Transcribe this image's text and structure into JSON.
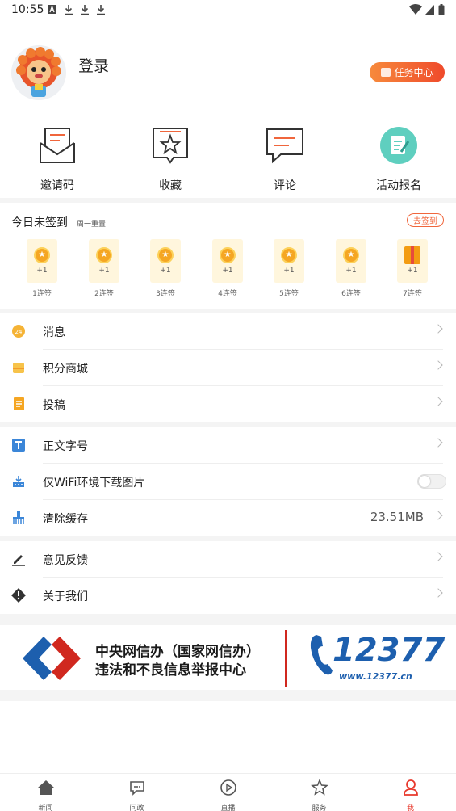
{
  "status_bar": {
    "time": "10:55"
  },
  "profile": {
    "login_label": "登录",
    "task_center_label": "任务中心"
  },
  "quick_actions": [
    {
      "label": "邀请码",
      "icon": "envelope-icon"
    },
    {
      "label": "收藏",
      "icon": "star-bookmark-icon"
    },
    {
      "label": "评论",
      "icon": "comment-icon"
    },
    {
      "label": "活动报名",
      "icon": "signup-icon"
    }
  ],
  "sign_in": {
    "title": "今日未签到",
    "subtitle": "周一重置",
    "button_label": "去签到",
    "days": [
      {
        "reward": "+1",
        "label": "1连签",
        "icon": "coin-icon"
      },
      {
        "reward": "+1",
        "label": "2连签",
        "icon": "coin-icon"
      },
      {
        "reward": "+1",
        "label": "3连签",
        "icon": "coin-icon"
      },
      {
        "reward": "+1",
        "label": "4连签",
        "icon": "coin-icon"
      },
      {
        "reward": "+1",
        "label": "5连签",
        "icon": "coin-icon"
      },
      {
        "reward": "+1",
        "label": "6连签",
        "icon": "coin-icon"
      },
      {
        "reward": "+1",
        "label": "7连签",
        "icon": "gift-icon"
      }
    ]
  },
  "menu_group_1": [
    {
      "label": "消息",
      "icon": "message-icon"
    },
    {
      "label": "积分商城",
      "icon": "points-mall-icon"
    },
    {
      "label": "投稿",
      "icon": "submit-article-icon"
    }
  ],
  "menu_group_2": [
    {
      "label": "正文字号",
      "icon": "font-size-icon"
    },
    {
      "label": "仅WiFi环境下载图片",
      "icon": "wifi-download-icon",
      "toggle": false
    },
    {
      "label": "清除缓存",
      "icon": "clear-cache-icon",
      "value": "23.51MB"
    }
  ],
  "menu_group_3": [
    {
      "label": "意见反馈",
      "icon": "feedback-icon"
    },
    {
      "label": "关于我们",
      "icon": "about-icon"
    }
  ],
  "banner": {
    "line1": "中央网信办（国家网信办）",
    "line2": "违法和不良信息举报中心",
    "number": "12377",
    "url": "www.12377.cn"
  },
  "bottom_nav": [
    {
      "label": "新闻",
      "icon": "home-icon"
    },
    {
      "label": "问政",
      "icon": "chat-icon"
    },
    {
      "label": "直播",
      "icon": "play-icon"
    },
    {
      "label": "服务",
      "icon": "service-icon"
    },
    {
      "label": "我",
      "icon": "user-icon",
      "active": true
    }
  ],
  "colors": {
    "accent": "#e8392d",
    "task_gradient": [
      "#f78a3c",
      "#ef4a2b"
    ],
    "separator": "#f4f4f4"
  }
}
